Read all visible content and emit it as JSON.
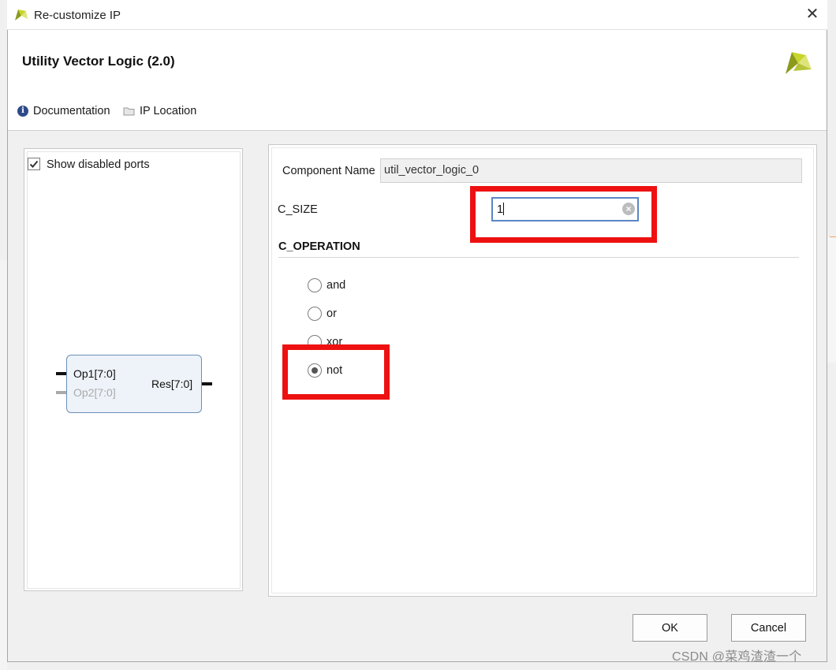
{
  "window": {
    "title": "Re-customize IP",
    "close_glyph": "✕"
  },
  "header": {
    "ip_title": "Utility Vector Logic (2.0)",
    "links": [
      {
        "label": "Documentation",
        "icon": "info-icon"
      },
      {
        "label": "IP Location",
        "icon": "folder-icon"
      }
    ]
  },
  "symbol_panel": {
    "show_disabled_ports_label": "Show disabled ports",
    "show_disabled_ports_checked": true,
    "block": {
      "inputs": [
        {
          "label": "Op1[7:0]",
          "enabled": true
        },
        {
          "label": "Op2[7:0]",
          "enabled": false
        }
      ],
      "outputs": [
        {
          "label": "Res[7:0]",
          "enabled": true
        }
      ]
    }
  },
  "params": {
    "component_name_label": "Component Name",
    "component_name_value": "util_vector_logic_0",
    "c_size_label": "C_SIZE",
    "c_size_value": "1",
    "c_operation_title": "C_OPERATION",
    "operations": [
      {
        "label": "and",
        "selected": false
      },
      {
        "label": "or",
        "selected": false
      },
      {
        "label": "xor",
        "selected": false
      },
      {
        "label": "not",
        "selected": true
      }
    ]
  },
  "buttons": {
    "ok": "OK",
    "cancel": "Cancel"
  },
  "watermark": "CSDN @菜鸡渣渣一个",
  "colors": {
    "highlight_red": "#ee1111",
    "logo_yellow": "#c8d52a",
    "logo_olive": "#8c9a1c",
    "focus_blue": "#5b86c5"
  }
}
